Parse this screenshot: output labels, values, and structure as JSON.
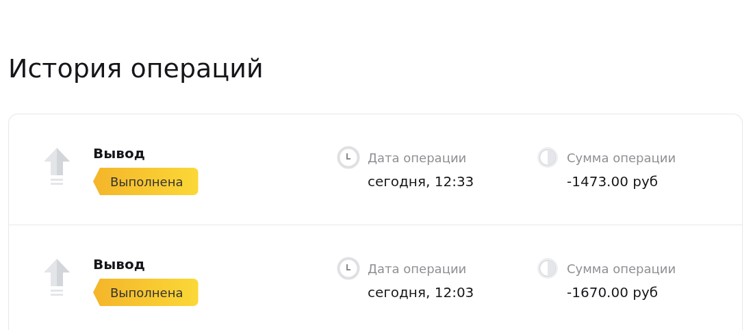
{
  "title": "История операций",
  "operations": [
    {
      "type": "Вывод",
      "status": "Выполнена",
      "date_label": "Дата операции",
      "date": "сегодня, 12:33",
      "sum_label": "Сумма операции",
      "sum": "-1473.00 руб"
    },
    {
      "type": "Вывод",
      "status": "Выполнена",
      "date_label": "Дата операции",
      "date": "сегодня, 12:03",
      "sum_label": "Сумма операции",
      "sum": "-1670.00 руб"
    }
  ]
}
